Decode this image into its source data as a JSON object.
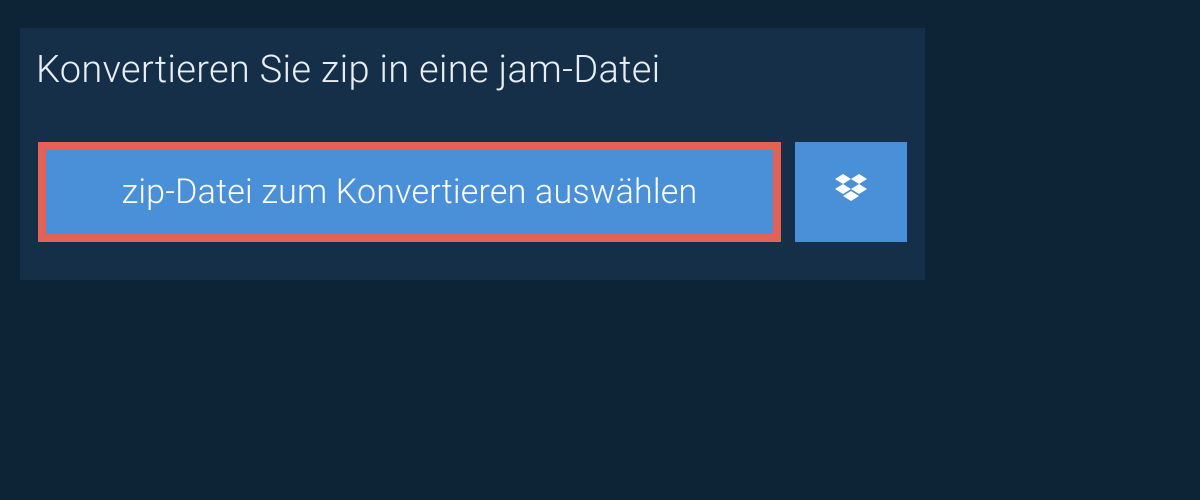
{
  "header": {
    "title": "Konvertieren Sie zip in eine jam-Datei"
  },
  "actions": {
    "select_file_label": "zip-Datei zum Konvertieren auswählen"
  },
  "colors": {
    "background": "#0d2437",
    "panel": "#142f47",
    "button": "#4990d9",
    "highlight_border": "#e46255",
    "text": "#ffffff"
  }
}
